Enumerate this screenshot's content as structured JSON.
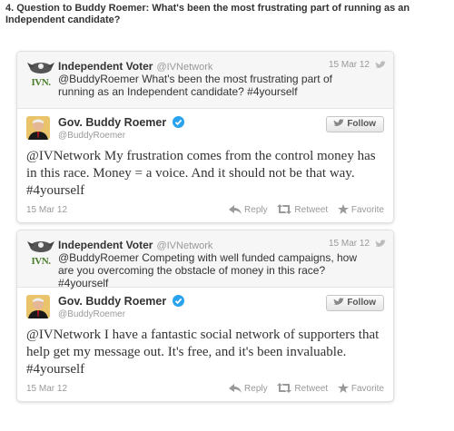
{
  "question": "4. Question to Buddy Roemer: What's been the most frustrating part of running as an Independent candidate?",
  "colors": {
    "accent_blue": "#2aa3ef",
    "logo_green": "#4a7d2a"
  },
  "tweets": [
    {
      "parent": {
        "name": "Independent Voter",
        "handle": "@IVNetwork",
        "date": "15 Mar 12",
        "logo_text": "IVN.",
        "text": "@BuddyRoemer What's been the most frustrating part of running as an Independent candidate? #4yourself"
      },
      "main": {
        "name": "Gov. Buddy Roemer",
        "handle": "@BuddyRoemer",
        "follow_label": "Follow",
        "text": "@IVNetwork My frustration comes from the control money has in this race. Money = a voice. And it should not be that way. #4yourself",
        "date": "15 Mar 12",
        "actions": {
          "reply": "Reply",
          "retweet": "Retweet",
          "favorite": "Favorite"
        }
      }
    },
    {
      "parent": {
        "name": "Independent Voter",
        "handle": "@IVNetwork",
        "date": "15 Mar 12",
        "logo_text": "IVN.",
        "text": "@BuddyRoemer Competing with well funded campaigns, how are you overcoming the obstacle of money in this race? #4yourself"
      },
      "main": {
        "name": "Gov. Buddy Roemer",
        "handle": "@BuddyRoemer",
        "follow_label": "Follow",
        "text": "@IVNetwork I have a fantastic social network of supporters that help get my message out. It's free, and it's been invaluable. #4yourself",
        "date": "15 Mar 12",
        "actions": {
          "reply": "Reply",
          "retweet": "Retweet",
          "favorite": "Favorite"
        }
      }
    }
  ]
}
